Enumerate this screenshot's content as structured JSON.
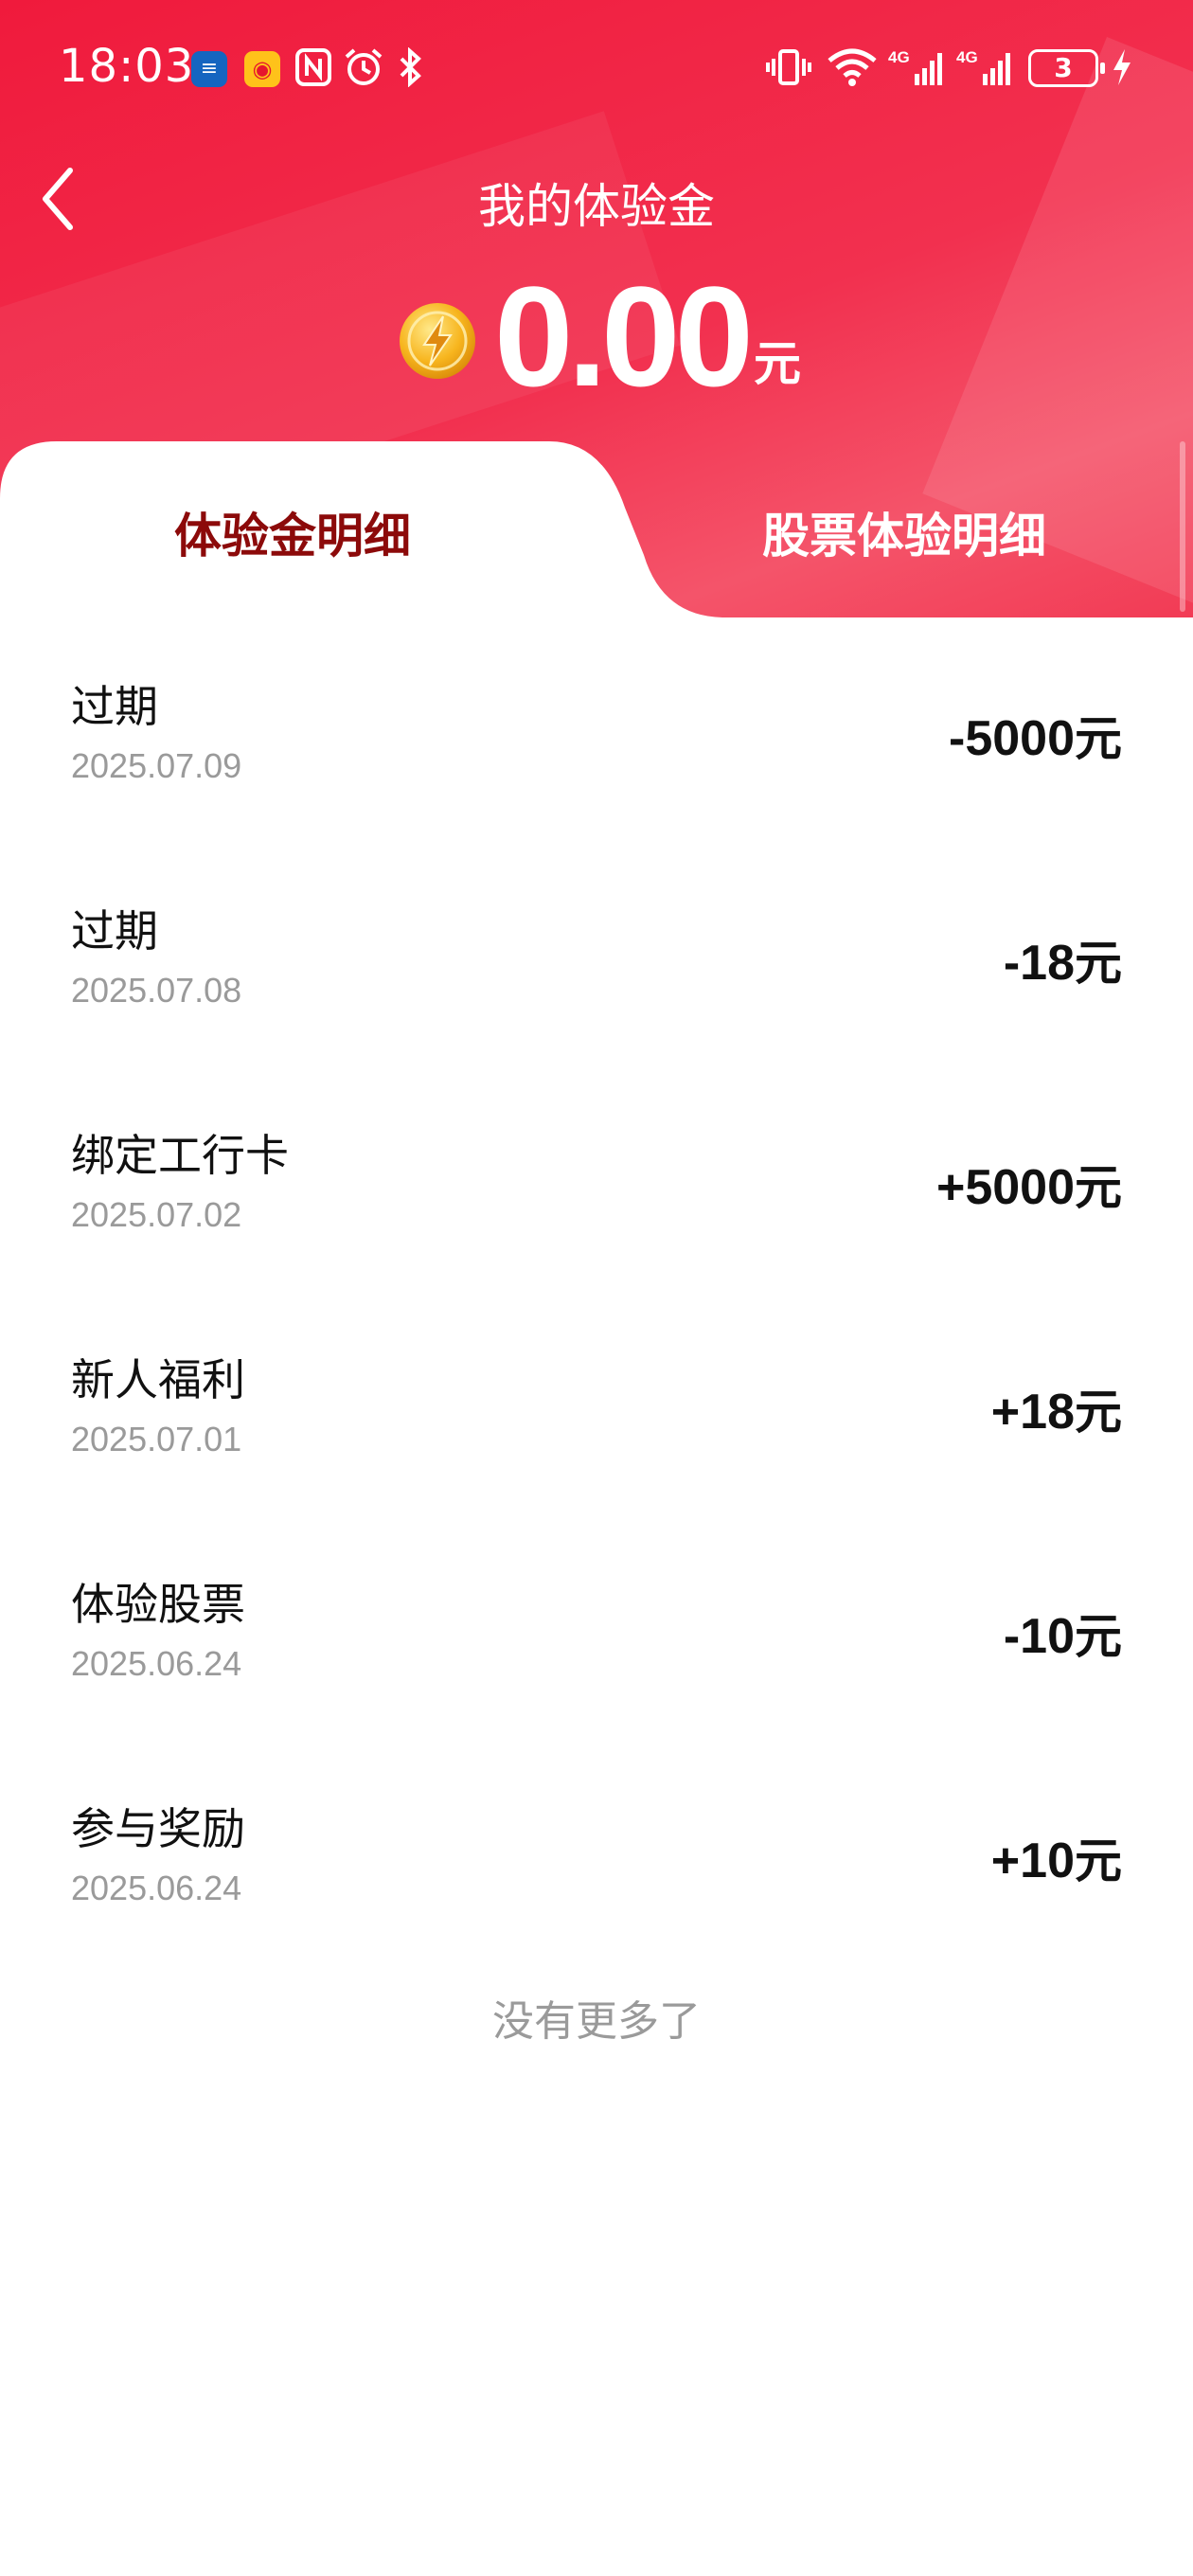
{
  "status_bar": {
    "time": "18:03",
    "battery": "3",
    "icons": [
      "blue-app-icon",
      "weibo-icon",
      "nfc-icon",
      "alarm-icon",
      "bluetooth-icon",
      "vibrate-icon",
      "wifi-icon",
      "signal-4g-icon",
      "signal-4g-icon",
      "battery-icon",
      "charging-icon"
    ]
  },
  "header": {
    "title": "我的体验金",
    "balance": "0.00",
    "balance_unit": "元",
    "colors": {
      "gradient_start": "#f01a3c",
      "gradient_end": "#f4546a",
      "active_tab_text": "#8c0a0a"
    }
  },
  "tabs": [
    {
      "label": "体验金明细",
      "active": true
    },
    {
      "label": "股票体验明细",
      "active": false
    }
  ],
  "records": [
    {
      "title": "过期",
      "date": "2025.07.09",
      "amount": "-5000",
      "unit": "元"
    },
    {
      "title": "过期",
      "date": "2025.07.08",
      "amount": "-18",
      "unit": "元"
    },
    {
      "title": "绑定工行卡",
      "date": "2025.07.02",
      "amount": "+5000",
      "unit": "元"
    },
    {
      "title": "新人福利",
      "date": "2025.07.01",
      "amount": "+18",
      "unit": "元"
    },
    {
      "title": "体验股票",
      "date": "2025.06.24",
      "amount": "-10",
      "unit": "元"
    },
    {
      "title": "参与奖励",
      "date": "2025.06.24",
      "amount": "+10",
      "unit": "元"
    }
  ],
  "footer": {
    "no_more": "没有更多了"
  }
}
